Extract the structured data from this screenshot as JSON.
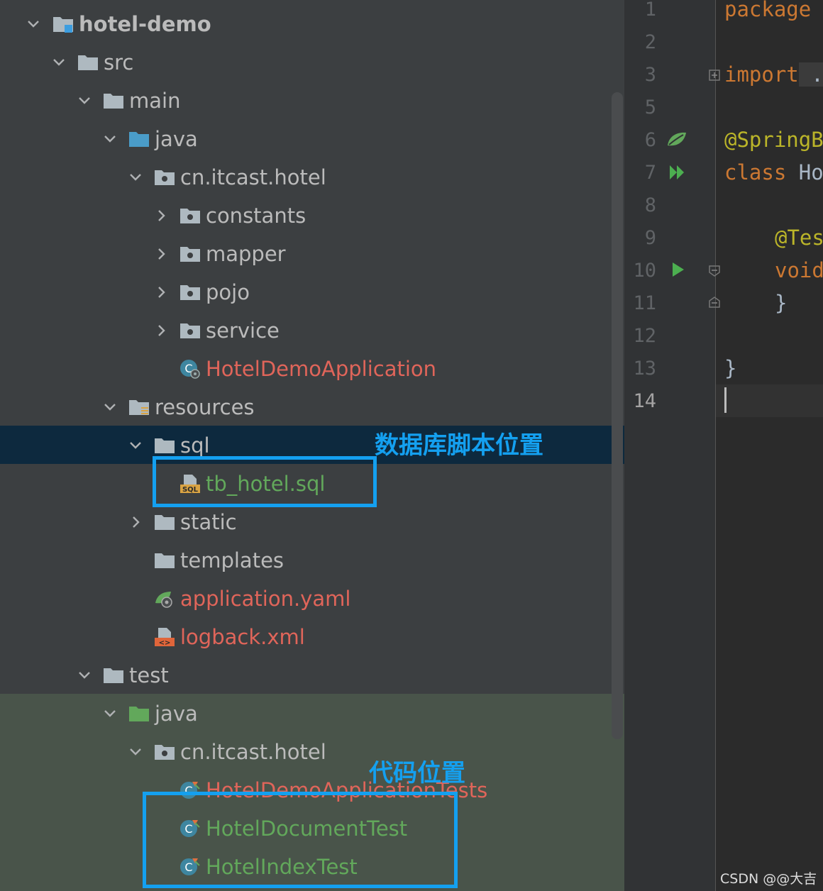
{
  "project_tree": {
    "items": [
      {
        "label": "hotel-demo"
      },
      {
        "label": "src"
      },
      {
        "label": "main"
      },
      {
        "label": "java"
      },
      {
        "label": "cn.itcast.hotel"
      },
      {
        "label": "constants"
      },
      {
        "label": "mapper"
      },
      {
        "label": "pojo"
      },
      {
        "label": "service"
      },
      {
        "label": "HotelDemoApplication"
      },
      {
        "label": "resources"
      },
      {
        "label": "sql"
      },
      {
        "label": "tb_hotel.sql"
      },
      {
        "label": "static"
      },
      {
        "label": "templates"
      },
      {
        "label": "application.yaml"
      },
      {
        "label": "logback.xml"
      },
      {
        "label": "test"
      },
      {
        "label": "java"
      },
      {
        "label": "cn.itcast.hotel"
      },
      {
        "label": "HotelDemoApplicationTests"
      },
      {
        "label": "HotelDocumentTest"
      },
      {
        "label": "HotelIndexTest"
      }
    ]
  },
  "editor": {
    "line_numbers": [
      "1",
      "2",
      "3",
      "5",
      "6",
      "7",
      "8",
      "9",
      "10",
      "11",
      "12",
      "13",
      "14"
    ],
    "code": {
      "package_kw": "package",
      "import_kw": "import",
      "import_rest": " .",
      "annotation": "@SpringB",
      "class_kw": "class",
      "class_name": " Ho",
      "test_annotation": "@Tes",
      "void_kw": "void",
      "close_inner": "}",
      "close_outer": "}"
    }
  },
  "annotations": {
    "sql_note": "数据库脚本位置",
    "code_note": "代码位置"
  },
  "watermark": "CSDN @@大吉",
  "colors": {
    "highlight_box": "#14a0f0",
    "selected_row": "#0d293e",
    "test_bg": "#49544a",
    "error_red": "#e0655a",
    "vcs_green": "#62a85b"
  }
}
